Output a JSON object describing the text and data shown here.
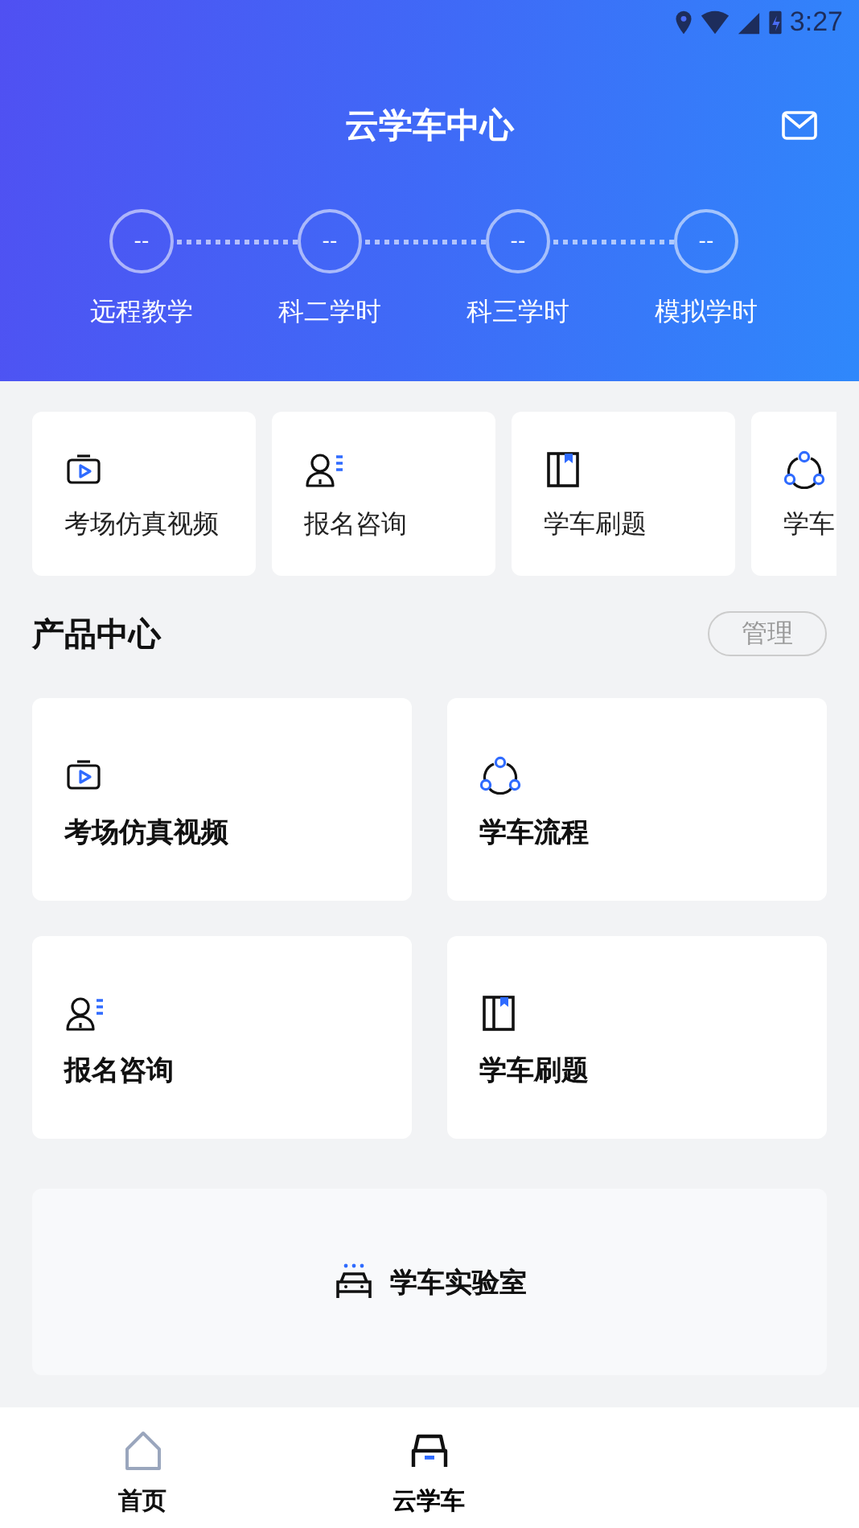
{
  "status_bar": {
    "time": "3:27"
  },
  "header": {
    "title": "云学车中心"
  },
  "steps": [
    {
      "value": "--",
      "label": "远程教学"
    },
    {
      "value": "--",
      "label": "科二学时"
    },
    {
      "value": "--",
      "label": "科三学时"
    },
    {
      "value": "--",
      "label": "模拟学时"
    }
  ],
  "quick_tiles": [
    {
      "kind": "video",
      "label": "考场仿真视频"
    },
    {
      "kind": "consult",
      "label": "报名咨询"
    },
    {
      "kind": "book",
      "label": "学车刷题"
    },
    {
      "kind": "flow",
      "label": "学车"
    }
  ],
  "product_center": {
    "title": "产品中心",
    "manage_button": "管理",
    "cards": [
      {
        "kind": "video",
        "label": "考场仿真视频"
      },
      {
        "kind": "flow",
        "label": "学车流程"
      },
      {
        "kind": "consult",
        "label": "报名咨询"
      },
      {
        "kind": "book",
        "label": "学车刷题"
      }
    ],
    "lab": {
      "kind": "car",
      "label": "学车实验室"
    }
  },
  "tab_bar": [
    {
      "kind": "home",
      "label": "首页",
      "selected": false
    },
    {
      "kind": "car",
      "label": "云学车",
      "selected": true
    }
  ]
}
